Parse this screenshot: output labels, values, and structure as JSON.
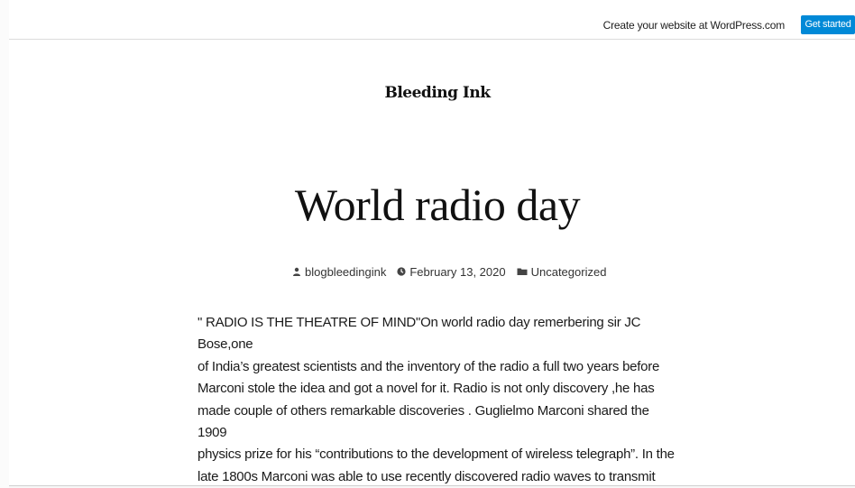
{
  "topbar": {
    "promo_text": "Create your website at WordPress.com",
    "cta_label": "Get started",
    "cta_color": "#0089d7"
  },
  "site": {
    "title": "Bleeding Ink"
  },
  "post": {
    "title": "World radio day",
    "meta": {
      "author_icon": "person-icon",
      "author": "blogbleedingink",
      "date_icon": "clock-icon",
      "date": "February 13, 2020",
      "category_icon": "folder-icon",
      "category": "Uncategorized"
    },
    "lines": [
      "\" RADIO IS THE THEATRE OF MIND\"On world radio day remerbering sir JC Bose,one",
      "of India’s greatest scientists and the inventory of the radio a full two years before",
      "Marconi stole the idea and got a novel for it. Radio is not only discovery ,he has",
      "made couple of others remarkable discoveries . Guglielmo Marconi shared the 1909",
      "physics prize for his “contributions to the development of wireless telegraph”. In the",
      "late 1800s Marconi was able to use recently discovered radio waves to transmit"
    ]
  }
}
